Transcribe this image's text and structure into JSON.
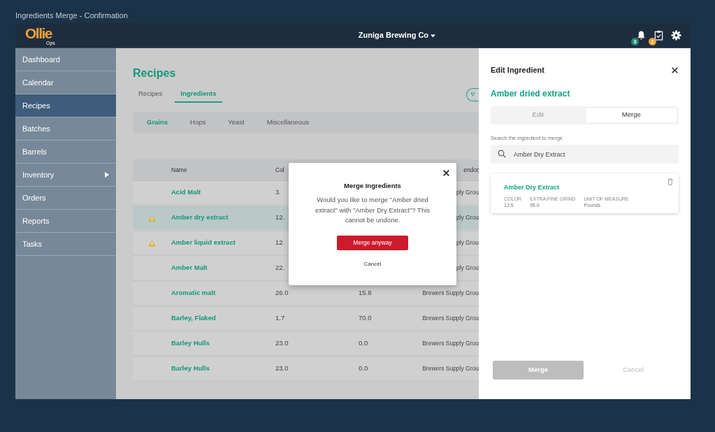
{
  "page_title": "Ingredients Merge - Confirmation",
  "navbar": {
    "logo": "Ollie",
    "logo_sub": "Ops",
    "company": "Zuniga Brewing Co",
    "notification_count": "3",
    "task_count": "1"
  },
  "sidebar": {
    "items": [
      {
        "label": "Dashboard",
        "selected": false,
        "expandable": false
      },
      {
        "label": "Calendar",
        "selected": false,
        "expandable": false
      },
      {
        "label": "Recipes",
        "selected": true,
        "expandable": false
      },
      {
        "label": "Batches",
        "selected": false,
        "expandable": false
      },
      {
        "label": "Barrels",
        "selected": false,
        "expandable": false
      },
      {
        "label": "Inventory",
        "selected": false,
        "expandable": true
      },
      {
        "label": "Orders",
        "selected": false,
        "expandable": false
      },
      {
        "label": "Reports",
        "selected": false,
        "expandable": false
      },
      {
        "label": "Tasks",
        "selected": false,
        "expandable": false
      }
    ]
  },
  "content": {
    "title": "Recipes",
    "tabs": [
      {
        "label": "Recipes",
        "selected": false
      },
      {
        "label": "Ingredients",
        "selected": true
      }
    ],
    "subtabs": [
      {
        "label": "Grains",
        "selected": true
      },
      {
        "label": "Hops",
        "selected": false
      },
      {
        "label": "Yeast",
        "selected": false
      },
      {
        "label": "Miscellaneous",
        "selected": false
      }
    ],
    "table": {
      "columns": {
        "name": "Name",
        "column_2": "Col",
        "column_4": "endor"
      },
      "rows": [
        {
          "warning": false,
          "selected": false,
          "name": "Acid Malt",
          "column_2": "3.",
          "column_4": "ply Grou"
        },
        {
          "warning": true,
          "selected": true,
          "name": "Amber dry extract",
          "column_2": "12.",
          "column_4": "ply Grou"
        },
        {
          "warning": true,
          "selected": false,
          "name": "Amber liquid extract",
          "column_2": "12.",
          "column_4": "ply Grou"
        },
        {
          "warning": false,
          "selected": false,
          "name": "Amber Malt",
          "column_2": "22.",
          "column_4": "ply Grou"
        },
        {
          "warning": false,
          "selected": false,
          "name": "Aromatic malt",
          "column_2": "26.0",
          "column_3": "15.8",
          "column_4": "Brewers Supply Grou"
        },
        {
          "warning": false,
          "selected": false,
          "name": "Barley, Flaked",
          "column_2": "1.7",
          "column_3": "70.0",
          "column_4": "Brewers Supply Grou"
        },
        {
          "warning": false,
          "selected": false,
          "name": "Barley Hulls",
          "column_2": "23.0",
          "column_3": "0.0",
          "column_4": "Brewers Supply Grou"
        },
        {
          "warning": false,
          "selected": false,
          "name": "Barley Hulls",
          "column_2": "23.0",
          "column_3": "0.0",
          "column_4": "Brewers Supply Grou"
        }
      ]
    }
  },
  "dialog": {
    "title": "Merge Ingredients",
    "message": "Would you like to merge \"Amber dried extract\" with \"Amber Dry Extract\"? This cannot be undone.",
    "confirm": "Merge anyway",
    "cancel": "Cancel"
  },
  "panel": {
    "title": "Edit Ingredient",
    "ingredient": "Amber dried extract",
    "modes": [
      {
        "label": "Edit",
        "selected": false
      },
      {
        "label": "Merge",
        "selected": true
      }
    ],
    "search_label": "Search the ingredient to merge",
    "search": {
      "value": "Amber Dry Extract"
    },
    "result": {
      "name": "Amber Dry Extract",
      "fields": [
        {
          "label": "COLOR",
          "value": "12.5"
        },
        {
          "label": "EXTRA FINE GRIND",
          "value": "95.0"
        },
        {
          "label": "UNIT OF MEASURE",
          "value": "Pounds"
        }
      ]
    },
    "merge_button": {
      "label": "Merge",
      "disabled": true
    },
    "cancel_button": "Cancel"
  }
}
